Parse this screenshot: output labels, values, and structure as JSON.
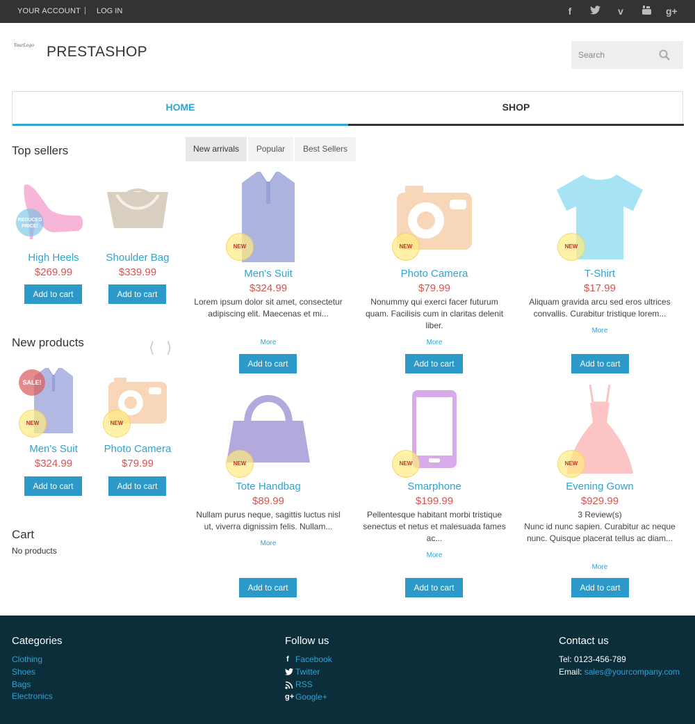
{
  "topbar": {
    "account": "YOUR ACCOUNT",
    "separator": "|",
    "login": "LOG IN",
    "social_icons": [
      "facebook-icon",
      "twitter-icon",
      "vimeo-icon",
      "youtube-icon",
      "google-plus-icon"
    ]
  },
  "header": {
    "logo_text": "YourLogo",
    "brand": "PRESTASHOP",
    "search_placeholder": "Search"
  },
  "nav": {
    "home": "HOME",
    "shop": "SHOP"
  },
  "sidebar": {
    "top_sellers": {
      "heading": "Top sellers",
      "items": [
        {
          "name": "High Heels",
          "price": "$269.99",
          "badge": "REDUCED PRICE!"
        },
        {
          "name": "Shoulder Bag",
          "price": "$339.99"
        }
      ]
    },
    "new_products": {
      "heading": "New products",
      "items": [
        {
          "name": "Men's Suit",
          "price": "$324.99",
          "badge_sale": "SALE!",
          "badge_new": "NEW"
        },
        {
          "name": "Photo Camera",
          "price": "$79.99",
          "badge_new": "NEW"
        }
      ]
    },
    "cart": {
      "heading": "Cart",
      "empty": "No products"
    },
    "add_to_cart": "Add to cart"
  },
  "main_tabs": [
    "New arrivals",
    "Popular",
    "Best Sellers"
  ],
  "products": [
    {
      "name": "Men's Suit",
      "price": "$324.99",
      "desc": "Lorem ipsum dolor sit amet, consectetur adipiscing elit. Maecenas et mi...",
      "more": "More",
      "badge": "NEW"
    },
    {
      "name": "Photo Camera",
      "price": "$79.99",
      "desc": "Nonummy qui exerci facer futurum quam. Facilisis cum in claritas delenit liber.",
      "more": "More",
      "badge": "NEW"
    },
    {
      "name": "T-Shirt",
      "price": "$17.99",
      "desc": "Aliquam gravida arcu sed eros ultrices convallis. Curabitur tristique lorem...",
      "more": "More",
      "badge": "NEW"
    },
    {
      "name": "Tote Handbag",
      "price": "$89.99",
      "desc": "Nullam purus neque, sagittis luctus nisl ut, viverra dignissim felis. Nullam...",
      "more": "More",
      "badge": "NEW"
    },
    {
      "name": "Smarphone",
      "price": "$199.99",
      "desc": "Pellentesque habitant morbi tristique senectus et netus et malesuada fames ac...",
      "more": "More",
      "badge": "NEW"
    },
    {
      "name": "Evening Gown",
      "price": "$929.99",
      "reviews": "3 Review(s)",
      "desc": "Nunc id nunc sapien. Curabitur ac neque nunc. Quisque placerat tellus ac diam...",
      "more": "More",
      "badge": "NEW"
    }
  ],
  "add_to_cart": "Add to cart",
  "footer": {
    "categories": {
      "heading": "Categories",
      "links": [
        "Clothing",
        "Shoes",
        "Bags",
        "Electronics"
      ]
    },
    "follow": {
      "heading": "Follow us",
      "links": [
        "Facebook",
        "Twitter",
        "RSS",
        "Google+"
      ]
    },
    "contact": {
      "heading": "Contact us",
      "tel": "Tel: 0123-456-789",
      "email_label": "Email: ",
      "email": "sales@yourcompany.com"
    }
  },
  "colors": {
    "accent": "#2fa3d3",
    "price": "#d9534f",
    "footer_bg": "#0b2e3a",
    "topbar_bg": "#333333"
  }
}
